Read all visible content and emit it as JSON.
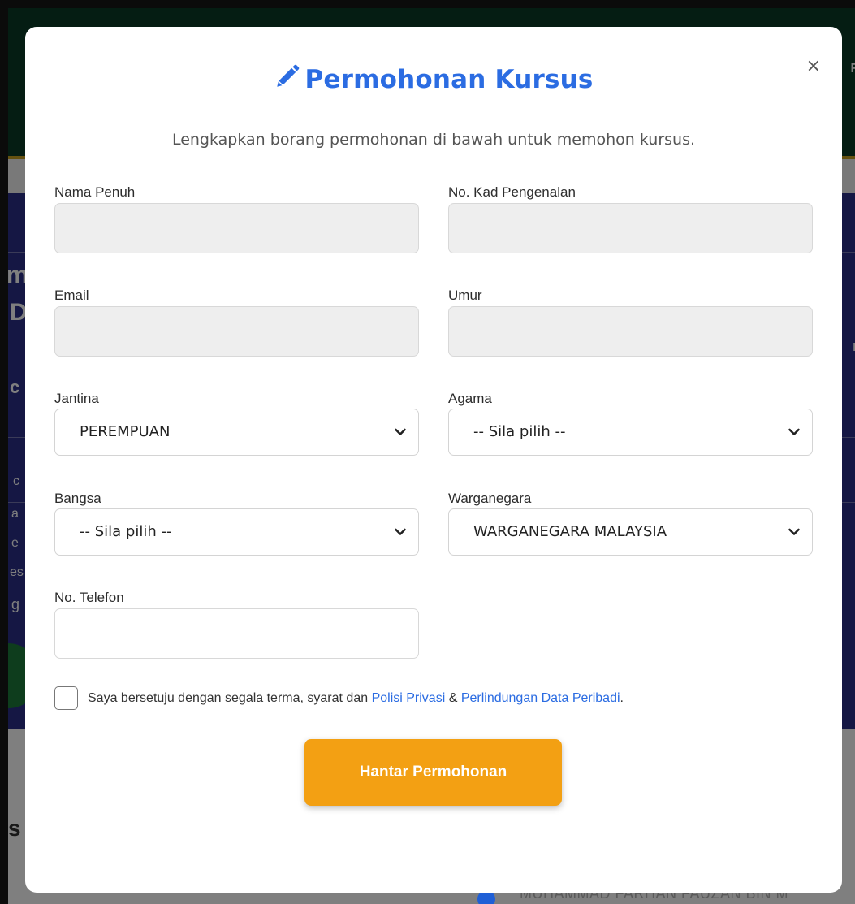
{
  "background": {
    "header_text": "R",
    "letters_left": [
      "m",
      "D",
      "c",
      "c",
      "a",
      "e",
      "es",
      "g"
    ],
    "letters_right": [
      "r"
    ],
    "lower_letter": "s",
    "bottom_name": "MUHAMMAD FARHAN FAUZAN BIN M"
  },
  "modal": {
    "title": "Permohonan Kursus",
    "subtitle": "Lengkapkan borang permohonan di bawah untuk memohon kursus.",
    "close_label": "×"
  },
  "form": {
    "nama_penuh": {
      "label": "Nama Penuh",
      "value": ""
    },
    "no_kad": {
      "label": "No. Kad Pengenalan",
      "value": ""
    },
    "email": {
      "label": "Email",
      "value": ""
    },
    "umur": {
      "label": "Umur",
      "value": ""
    },
    "jantina": {
      "label": "Jantina",
      "selected": "PEREMPUAN"
    },
    "agama": {
      "label": "Agama",
      "selected": "-- Sila pilih --"
    },
    "bangsa": {
      "label": "Bangsa",
      "selected": "-- Sila pilih --"
    },
    "warganegara": {
      "label": "Warganegara",
      "selected": "WARGANEGARA MALAYSIA"
    },
    "no_telefon": {
      "label": "No. Telefon",
      "value": ""
    }
  },
  "terms": {
    "text_before": "Saya bersetuju dengan segala terma, syarat dan",
    "link_privacy": "Polisi Privasi",
    "amp": "&",
    "link_data": "Perlindungan Data Peribadi",
    "period": "."
  },
  "submit_label": "Hantar Permohonan",
  "colors": {
    "accent": "#2b6ce2",
    "button": "#f3a013"
  },
  "icons": {
    "title_icon": "pencil-icon",
    "select_icon": "chevron-down-icon",
    "close_icon": "close-icon"
  }
}
